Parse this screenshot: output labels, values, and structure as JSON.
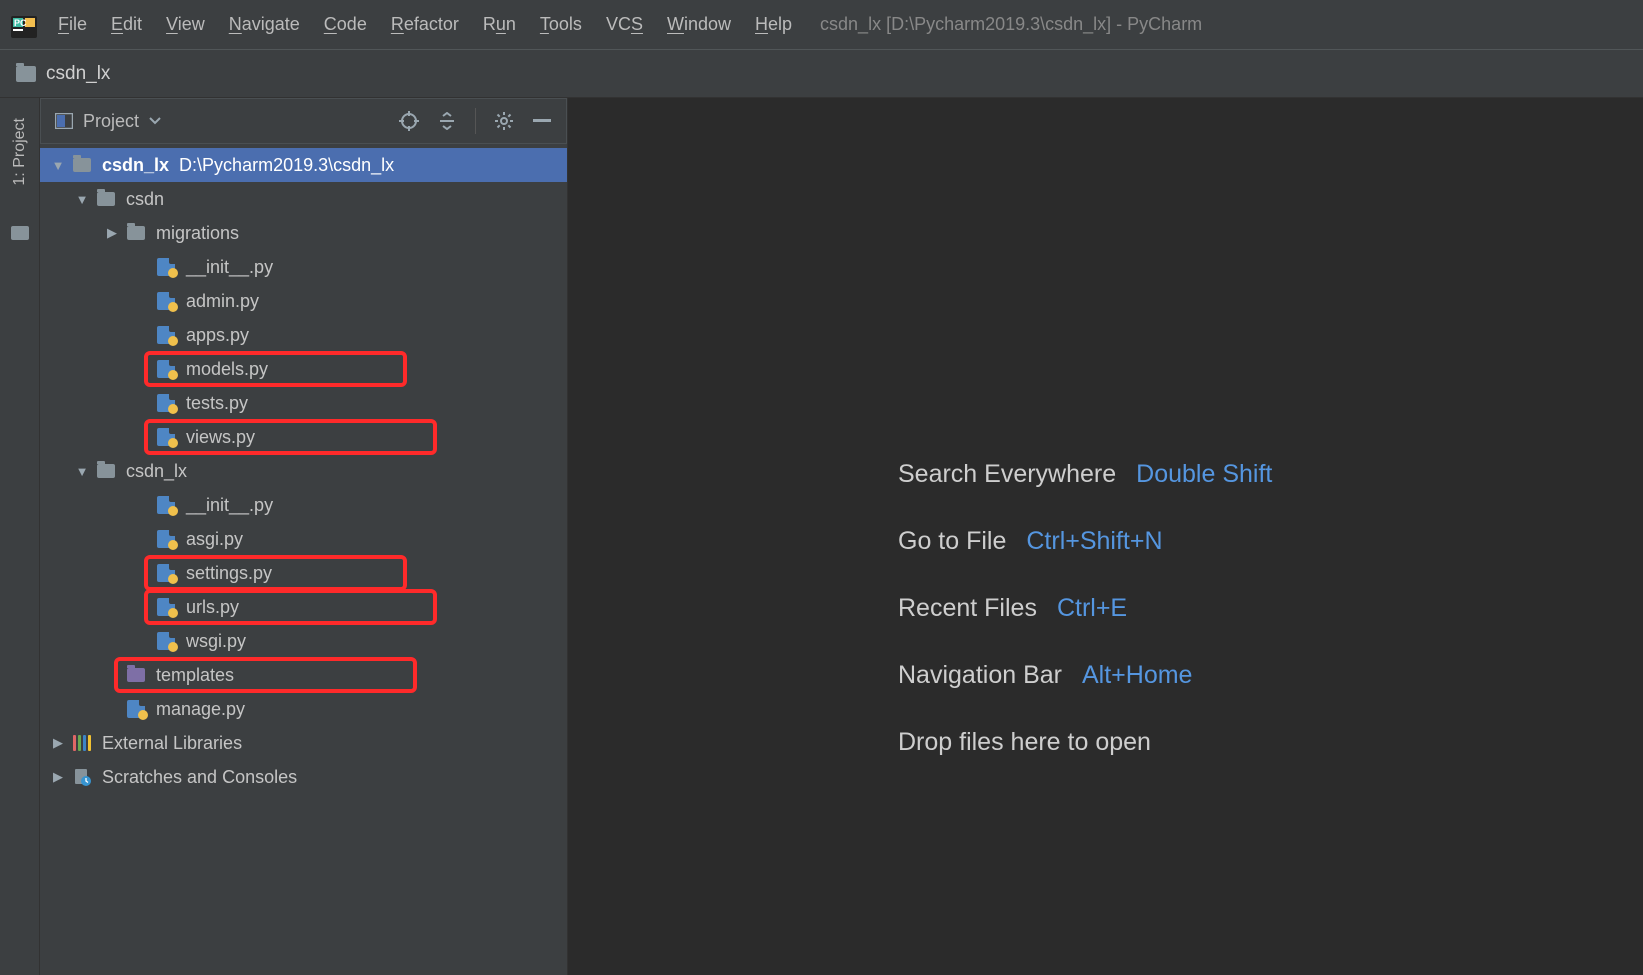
{
  "window": {
    "title": "csdn_lx [D:\\Pycharm2019.3\\csdn_lx] - PyCharm"
  },
  "menu": {
    "file": "File",
    "edit": "Edit",
    "view": "View",
    "navigate": "Navigate",
    "code": "Code",
    "refactor": "Refactor",
    "run": "Run",
    "tools": "Tools",
    "vcs": "VCS",
    "window": "Window",
    "help": "Help"
  },
  "breadcrumb": {
    "root": "csdn_lx"
  },
  "gutter": {
    "project_tab": "1: Project"
  },
  "project_panel": {
    "title": "Project"
  },
  "tree": {
    "root_name": "csdn_lx",
    "root_path": "D:\\Pycharm2019.3\\csdn_lx",
    "csdn": {
      "name": "csdn",
      "migrations": "migrations",
      "init": "__init__.py",
      "admin": "admin.py",
      "apps": "apps.py",
      "models": "models.py",
      "tests": "tests.py",
      "views": "views.py"
    },
    "csdn_lx": {
      "name": "csdn_lx",
      "init": "__init__.py",
      "asgi": "asgi.py",
      "settings": "settings.py",
      "urls": "urls.py",
      "wsgi": "wsgi.py"
    },
    "templates": "templates",
    "manage": "manage.py",
    "external_libraries": "External Libraries",
    "scratches": "Scratches and Consoles"
  },
  "tips": {
    "search_label": "Search Everywhere",
    "search_key": "Double Shift",
    "gotofile_label": "Go to File",
    "gotofile_key": "Ctrl+Shift+N",
    "recent_label": "Recent Files",
    "recent_key": "Ctrl+E",
    "navbar_label": "Navigation Bar",
    "navbar_key": "Alt+Home",
    "drop_label": "Drop files here to open"
  }
}
